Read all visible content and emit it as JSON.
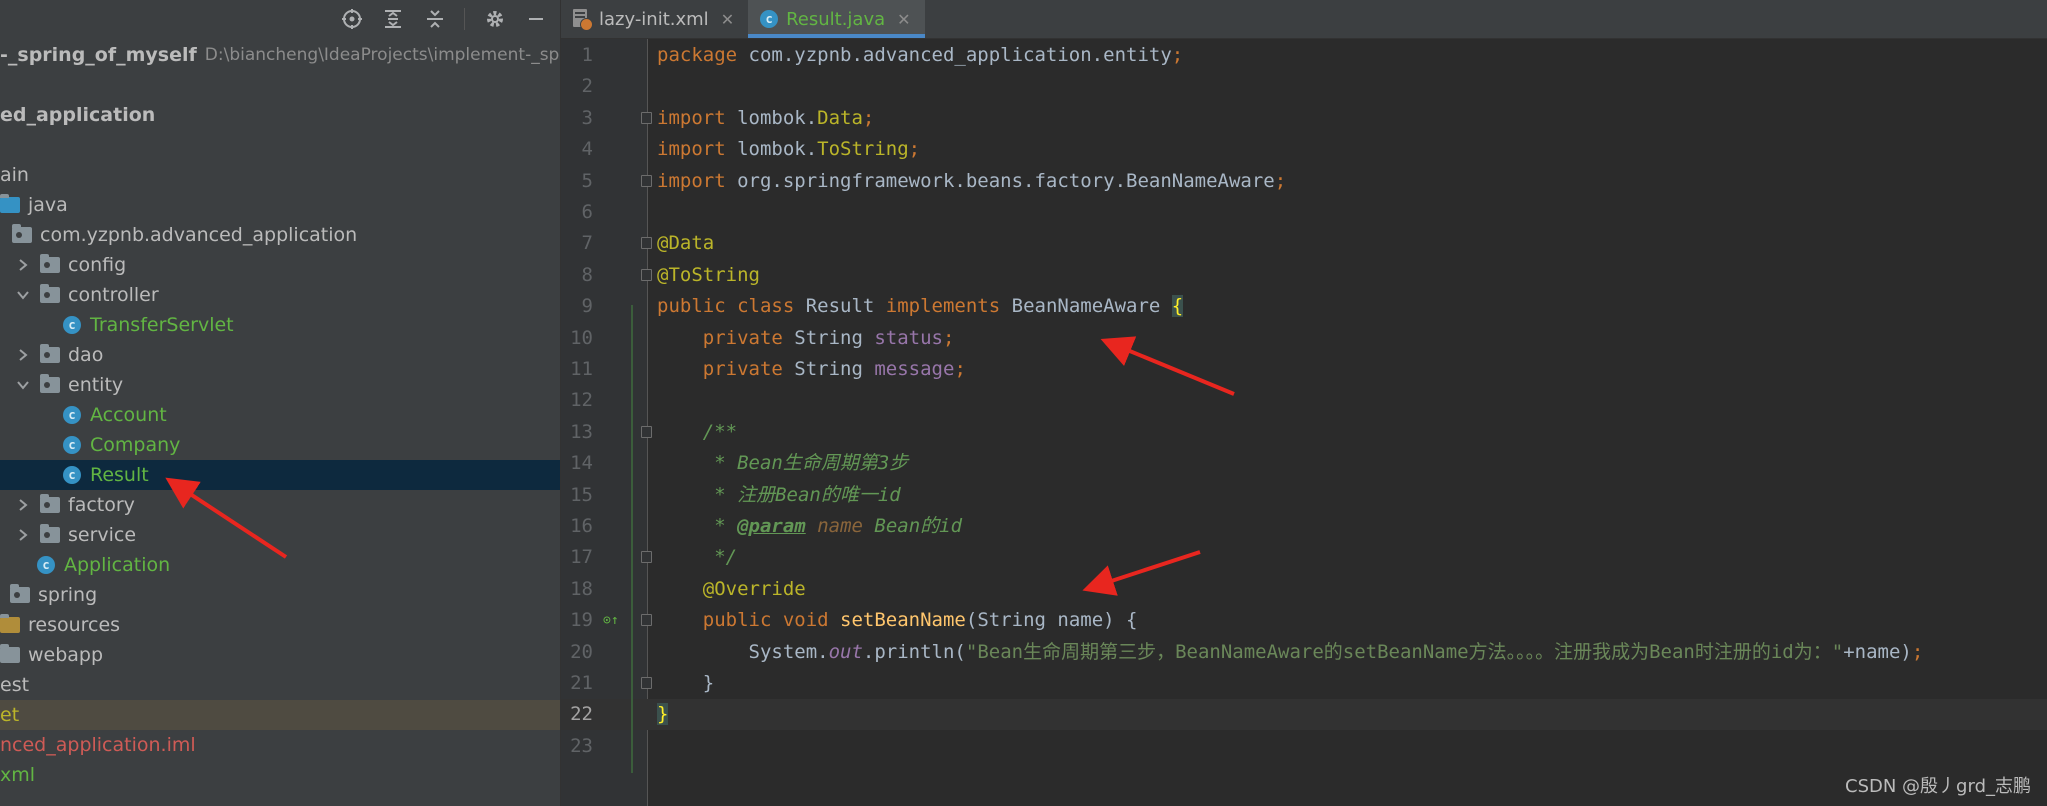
{
  "project_panel": {
    "toolbar_icons": [
      "crosshair-icon",
      "expand-all-icon",
      "collapse-all-icon",
      "gear-icon",
      "minimize-icon"
    ],
    "tree": [
      {
        "label": "-_spring_of_myself",
        "extra": "D:\\biancheng\\IdeaProjects\\implement-_sprin",
        "bold": true,
        "color": "#bbbbbb",
        "icon": "none",
        "chevron": "none"
      },
      {
        "label": "ed_application",
        "bold": true,
        "color": "#bbbbbb",
        "icon": "none",
        "chevron": "none"
      },
      {
        "label": "ain",
        "color": "#bbbbbb",
        "icon": "none",
        "chevron": "none"
      },
      {
        "label": "java",
        "color": "#bbbbbb",
        "icon": "folder-source",
        "chevron": "none"
      },
      {
        "label": "com.yzpnb.advanced_application",
        "color": "#bbbbbb",
        "icon": "folder-package",
        "chevron": "none"
      },
      {
        "label": "config",
        "color": "#bbbbbb",
        "icon": "folder-package",
        "chevron": "right"
      },
      {
        "label": "controller",
        "color": "#bbbbbb",
        "icon": "folder-package",
        "chevron": "down"
      },
      {
        "label": "TransferServlet",
        "color": "#62b543",
        "icon": "class",
        "chevron": "none"
      },
      {
        "label": "dao",
        "color": "#bbbbbb",
        "icon": "folder-package",
        "chevron": "right"
      },
      {
        "label": "entity",
        "color": "#bbbbbb",
        "icon": "folder-package",
        "chevron": "down"
      },
      {
        "label": "Account",
        "color": "#62b543",
        "icon": "class",
        "chevron": "none"
      },
      {
        "label": "Company",
        "color": "#62b543",
        "icon": "class",
        "chevron": "none"
      },
      {
        "label": "Result",
        "color": "#62b543",
        "icon": "class",
        "chevron": "none",
        "selected": true
      },
      {
        "label": "factory",
        "color": "#bbbbbb",
        "icon": "folder-package",
        "chevron": "right"
      },
      {
        "label": "service",
        "color": "#bbbbbb",
        "icon": "folder-package",
        "chevron": "right"
      },
      {
        "label": "Application",
        "color": "#62b543",
        "icon": "class-run",
        "chevron": "none"
      },
      {
        "label": "spring",
        "color": "#bbbbbb",
        "icon": "folder-package",
        "chevron": "none"
      },
      {
        "label": "resources",
        "color": "#bbbbbb",
        "icon": "folder-resources",
        "chevron": "none"
      },
      {
        "label": "webapp",
        "color": "#bbbbbb",
        "icon": "folder-web",
        "chevron": "none"
      },
      {
        "label": "est",
        "color": "#bbbbbb",
        "icon": "none",
        "chevron": "none"
      },
      {
        "label": "et",
        "color": "#bbb529",
        "icon": "none",
        "chevron": "none",
        "ignored": true
      },
      {
        "label": "nced_application.iml",
        "color": "#cf5b56",
        "icon": "none",
        "chevron": "none"
      },
      {
        "label": "xml",
        "color": "#62b543",
        "icon": "none",
        "chevron": "none"
      }
    ]
  },
  "tabs": [
    {
      "label": "lazy-init.xml",
      "icon": "xml-file-icon",
      "active": false
    },
    {
      "label": "Result.java",
      "icon": "class-icon",
      "active": true
    }
  ],
  "editor": {
    "current_line": 22,
    "lines": [
      [
        [
          "kw",
          "package "
        ],
        [
          "",
          "com.yzpnb.advanced_application.entity"
        ],
        [
          "kw",
          ";"
        ]
      ],
      [],
      [
        [
          "kw",
          "import "
        ],
        [
          "",
          "lombok."
        ],
        [
          "an",
          "Data"
        ],
        [
          "kw",
          ";"
        ]
      ],
      [
        [
          "kw",
          "import "
        ],
        [
          "",
          "lombok."
        ],
        [
          "an",
          "ToString"
        ],
        [
          "kw",
          ";"
        ]
      ],
      [
        [
          "kw",
          "import "
        ],
        [
          "",
          "org.springframework.beans.factory.BeanNameAware"
        ],
        [
          "kw",
          ";"
        ]
      ],
      [],
      [
        [
          "an",
          "@Data"
        ]
      ],
      [
        [
          "an",
          "@ToString"
        ]
      ],
      [
        [
          "kw",
          "public class "
        ],
        [
          "",
          "Result "
        ],
        [
          "kw",
          "implements "
        ],
        [
          "",
          "BeanNameAware "
        ],
        [
          "brace",
          "{"
        ]
      ],
      [
        [
          "",
          "    "
        ],
        [
          "kw",
          "private "
        ],
        [
          "",
          "String "
        ],
        [
          "fld",
          "status"
        ],
        [
          "kw",
          ";"
        ]
      ],
      [
        [
          "",
          "    "
        ],
        [
          "kw",
          "private "
        ],
        [
          "",
          "String "
        ],
        [
          "fld",
          "message"
        ],
        [
          "kw",
          ";"
        ]
      ],
      [],
      [
        [
          "",
          "    "
        ],
        [
          "cm",
          "/**"
        ]
      ],
      [
        [
          "",
          "    "
        ],
        [
          "cm",
          " * Bean生命周期第3步"
        ]
      ],
      [
        [
          "",
          "    "
        ],
        [
          "cm",
          " * 注册Bean的唯一id"
        ]
      ],
      [
        [
          "",
          "    "
        ],
        [
          "cm",
          " * "
        ],
        [
          "tag",
          "@param"
        ],
        [
          "cm",
          " "
        ],
        [
          "prm",
          "name"
        ],
        [
          "cm",
          " Bean的id"
        ]
      ],
      [
        [
          "",
          "    "
        ],
        [
          "cm",
          " */"
        ]
      ],
      [
        [
          "",
          "    "
        ],
        [
          "an",
          "@Override"
        ]
      ],
      [
        [
          "",
          "    "
        ],
        [
          "kw",
          "public void "
        ],
        [
          "fn",
          "setBeanName"
        ],
        [
          "",
          "(String name) {"
        ]
      ],
      [
        [
          "",
          "        System."
        ],
        [
          "st",
          "out"
        ],
        [
          "",
          ".println("
        ],
        [
          "str",
          "\"Bean生命周期第三步，BeanNameAware的setBeanName方法。。。。注册我成为Bean时注册的id为：\""
        ],
        [
          "",
          "+name)"
        ],
        [
          "kw",
          ";"
        ]
      ],
      [
        [
          "",
          "    }"
        ]
      ],
      [
        [
          "brace",
          "}"
        ]
      ],
      []
    ],
    "fold_lines": [
      3,
      5,
      7,
      8,
      13,
      17,
      19,
      21
    ],
    "override_marker_line": 19
  },
  "watermark": "CSDN @殷丿grd_志鹏"
}
